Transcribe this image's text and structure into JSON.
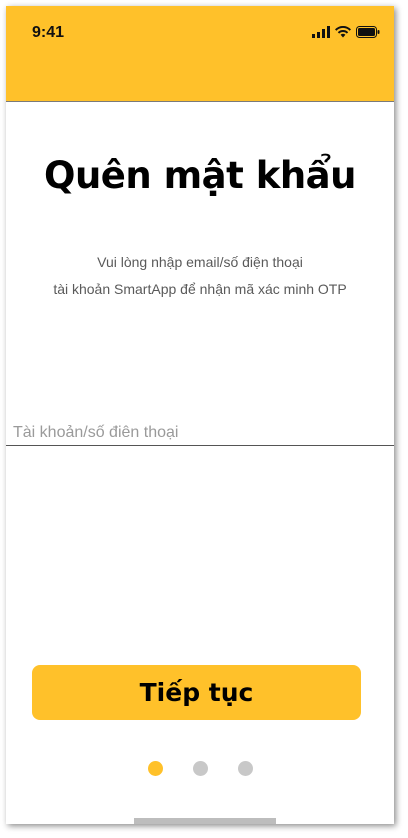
{
  "status_bar": {
    "time": "9:41"
  },
  "page": {
    "title": "Quên mật khẩu",
    "subtitle_line1": "Vui lòng nhập email/số điện thoại",
    "subtitle_line2": "tài khoản SmartApp để nhận mã xác minh OTP"
  },
  "form": {
    "account_placeholder": "Tài khoản/số điên thoại",
    "account_value": ""
  },
  "actions": {
    "continue_label": "Tiếp tục"
  },
  "pagination": {
    "total": 3,
    "active_index": 0
  },
  "colors": {
    "accent": "#FFC12A",
    "dot_inactive": "#c8c8c8"
  },
  "icons": [
    "signal-icon",
    "wifi-icon",
    "battery-icon"
  ]
}
